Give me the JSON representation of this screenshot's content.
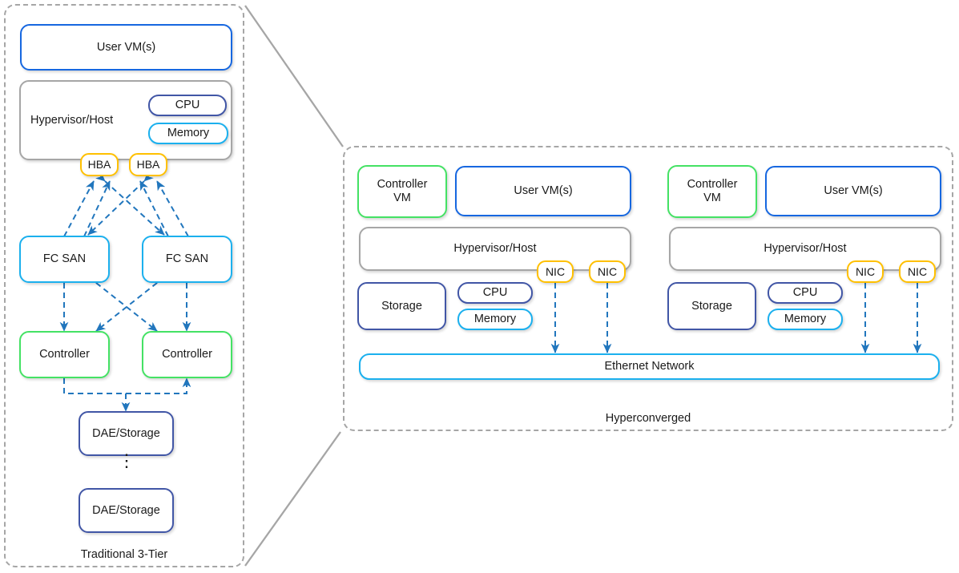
{
  "diagram": {
    "title_left": "Traditional 3-Tier",
    "title_right": "Hyperconverged",
    "colors": {
      "blue": "#1667e0",
      "gray": "#a6a6a6",
      "navy": "#4156a6",
      "cyan": "#1bb0ee",
      "amber": "#ffc000",
      "green": "#44e264",
      "arrow": "#2176bd",
      "panel_border": "#a6a6a6"
    }
  },
  "left_panel": {
    "label": "Traditional 3-Tier",
    "user_vm": "User VM(s)",
    "hypervisor": "Hypervisor/Host",
    "cpu": "CPU",
    "memory": "Memory",
    "hba_1": "HBA",
    "hba_2": "HBA",
    "fc_san_1": "FC SAN",
    "fc_san_2": "FC SAN",
    "controller_1": "Controller",
    "controller_2": "Controller",
    "dae_1": "DAE/Storage",
    "dae_2": "DAE/Storage",
    "ellipsis": "⋮"
  },
  "right_panel": {
    "label": "Hyperconverged",
    "ethernet": "Ethernet Network",
    "hosts": [
      {
        "controller_vm": "Controller\nVM",
        "controller_vm_line1": "Controller",
        "controller_vm_line2": "VM",
        "user_vm": "User VM(s)",
        "hypervisor": "Hypervisor/Host",
        "storage": "Storage",
        "cpu": "CPU",
        "memory": "Memory",
        "nic_1": "NIC",
        "nic_2": "NIC"
      },
      {
        "controller_vm": "Controller\nVM",
        "controller_vm_line1": "Controller",
        "controller_vm_line2": "VM",
        "user_vm": "User VM(s)",
        "hypervisor": "Hypervisor/Host",
        "storage": "Storage",
        "cpu": "CPU",
        "memory": "Memory",
        "nic_1": "NIC",
        "nic_2": "NIC"
      }
    ]
  }
}
